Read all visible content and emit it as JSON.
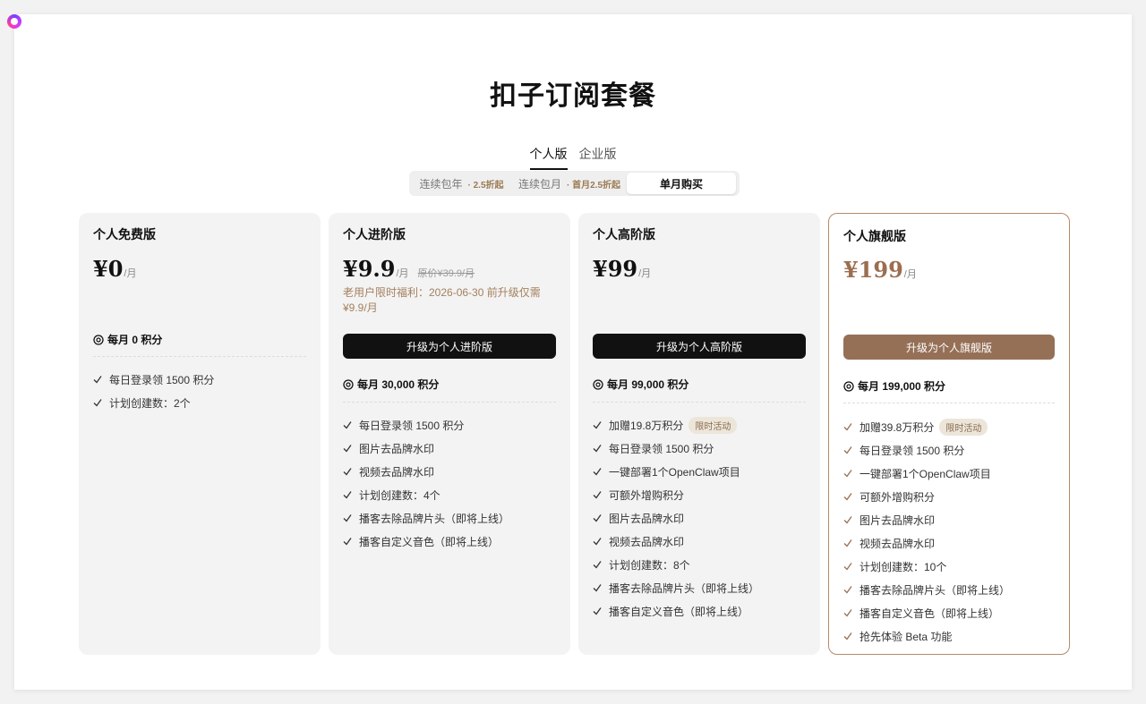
{
  "title": "扣子订阅套餐",
  "tabs": [
    {
      "label": "个人版",
      "active": true
    },
    {
      "label": "企业版",
      "active": false
    }
  ],
  "billing": [
    {
      "label": "连续包年",
      "discount": "· 2.5折起"
    },
    {
      "label": "连续包月",
      "discount": "· 首月2.5折起"
    },
    {
      "label": "单月购买",
      "discount": ""
    }
  ],
  "plans": [
    {
      "name": "个人免费版",
      "price": "¥0",
      "per": "/月",
      "credits": "每月 0 积分",
      "features": [
        "每日登录领 1500 积分",
        "计划创建数：2个"
      ]
    },
    {
      "name": "个人进阶版",
      "price": "¥9.9",
      "per": "/月",
      "original": "原价¥39.9/月",
      "promo": "老用户限时福利：2026-06-30 前升级仅需¥9.9/月",
      "cta": "升级为个人进阶版",
      "credits": "每月 30,000 积分",
      "features": [
        "每日登录领 1500 积分",
        "图片去品牌水印",
        "视频去品牌水印",
        "计划创建数：4个",
        "播客去除品牌片头（即将上线）",
        "播客自定义音色（即将上线）"
      ]
    },
    {
      "name": "个人高阶版",
      "price": "¥99",
      "per": "/月",
      "cta": "升级为个人高阶版",
      "credits": "每月 99,000 积分",
      "badge": "限时活动",
      "features": [
        "加赠19.8万积分",
        "每日登录领 1500 积分",
        "一键部署1个OpenClaw项目",
        "可额外增购积分",
        "图片去品牌水印",
        "视频去品牌水印",
        "计划创建数：8个",
        "播客去除品牌片头（即将上线）",
        "播客自定义音色（即将上线）"
      ]
    },
    {
      "name": "个人旗舰版",
      "price": "¥199",
      "per": "/月",
      "cta": "升级为个人旗舰版",
      "credits": "每月 199,000 积分",
      "badge": "限时活动",
      "features": [
        "加赠39.8万积分",
        "每日登录领 1500 积分",
        "一键部署1个OpenClaw项目",
        "可额外增购积分",
        "图片去品牌水印",
        "视频去品牌水印",
        "计划创建数：10个",
        "播客去除品牌片头（即将上线）",
        "播客自定义音色（即将上线）",
        "抢先体验 Beta 功能"
      ]
    }
  ],
  "colors": {
    "accent": "#957056",
    "price_accent": "#9b6e4f",
    "promo": "#a5805e"
  }
}
